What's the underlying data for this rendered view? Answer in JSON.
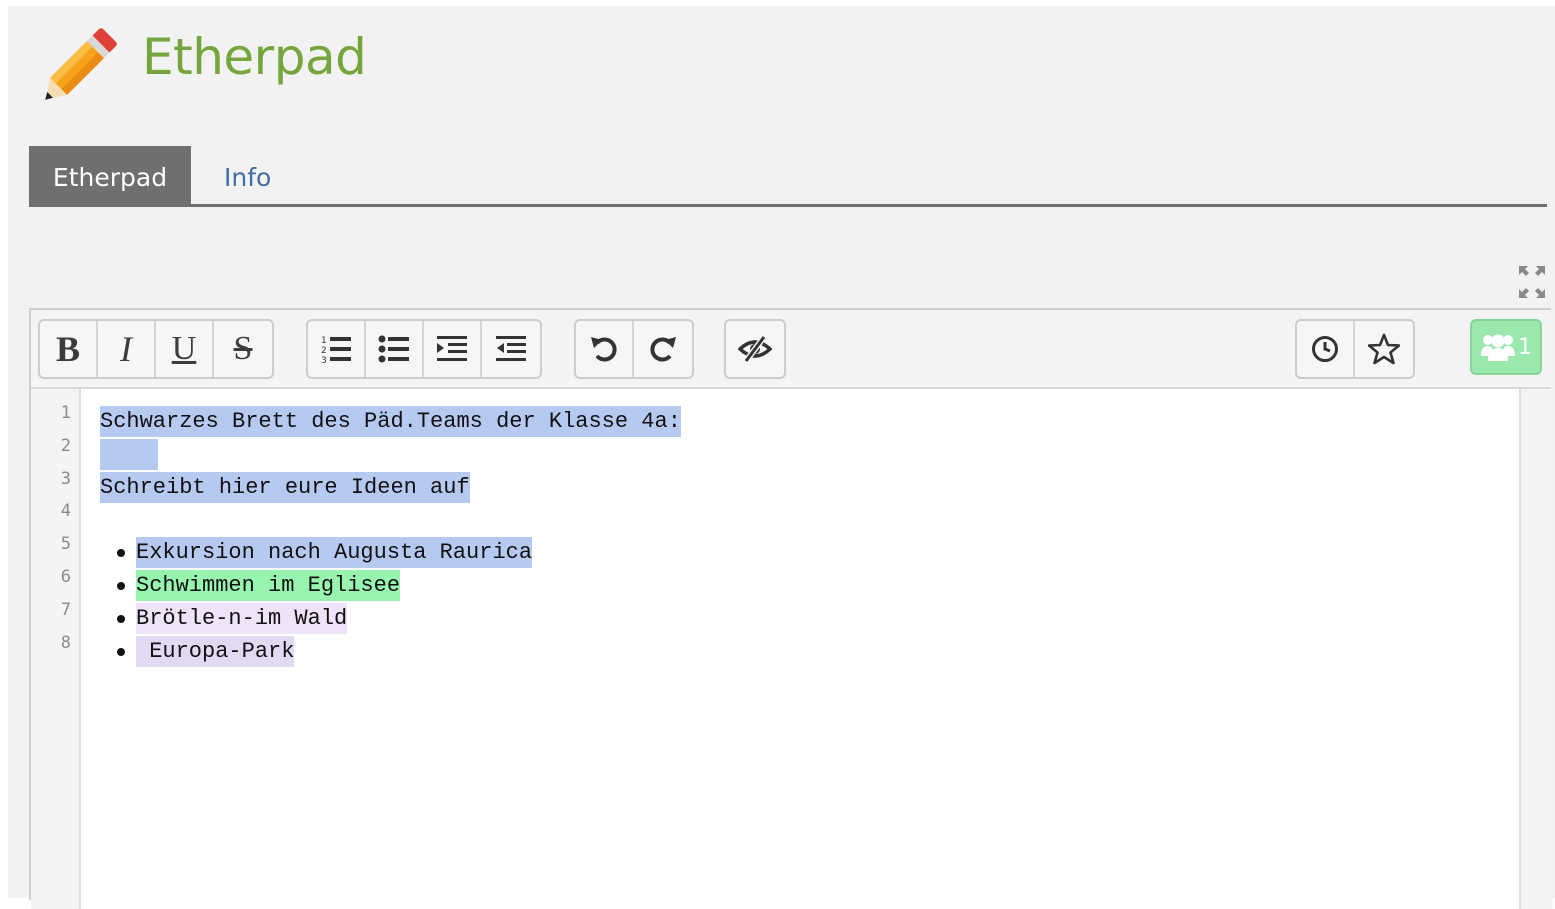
{
  "app": {
    "title": "Etherpad",
    "logo_icon": "pencil-icon"
  },
  "tabs": [
    {
      "label": "Etherpad",
      "active": true
    },
    {
      "label": "Info",
      "active": false
    }
  ],
  "toolbar": {
    "format": {
      "bold": "B",
      "italic": "I",
      "underline": "U",
      "strikethrough": "S"
    },
    "list_icons": [
      "ordered-list-icon",
      "unordered-list-icon",
      "indent-icon",
      "outdent-icon"
    ],
    "history_icons": [
      "undo-icon",
      "redo-icon"
    ],
    "visibility_icon": "eye-slash-icon",
    "right_icons": [
      "clock-icon",
      "star-icon"
    ],
    "users": {
      "icon": "users-icon",
      "count": "1"
    }
  },
  "colors": {
    "brand_green": "#75a63d",
    "tab_active": "#6f6f6f",
    "tab_link": "#3f6fa3",
    "author_blue": "#b6c9f1",
    "author_green": "#97f5b0",
    "author_lilac": "#efe3fa",
    "author_purple": "#e2d9f3",
    "users_button": "#9be8ae"
  },
  "document": {
    "line_numbers": [
      "1",
      "2",
      "3",
      "4",
      "5",
      "6",
      "7",
      "8"
    ],
    "lines": [
      {
        "text": "Schwarzes Brett des Päd.Teams der Klasse 4a:",
        "author": "blue"
      },
      {
        "text": "    ",
        "author": "blue"
      },
      {
        "text": "Schreibt hier eure Ideen auf",
        "author": "blue"
      },
      {
        "text": "",
        "author": null
      },
      {
        "text": "Exkursion nach Augusta Raurica",
        "author": "blue",
        "list": "bullet"
      },
      {
        "text": "Schwimmen im Eglisee",
        "author": "green",
        "list": "bullet"
      },
      {
        "text": "Brötle-n-im Wald",
        "author": "lilac",
        "list": "bullet"
      },
      {
        "text": " Europa-Park",
        "author": "purple",
        "list": "bullet"
      }
    ]
  }
}
